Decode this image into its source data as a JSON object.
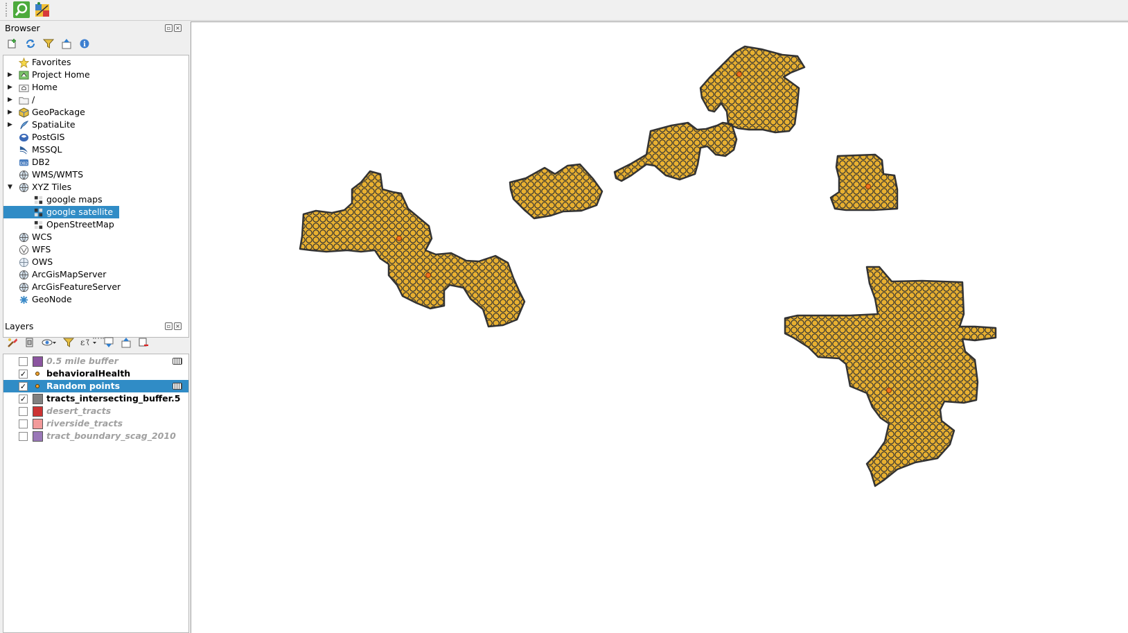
{
  "toolbar": {
    "icons": [
      "identify-icon",
      "georeference-icon"
    ]
  },
  "browser": {
    "title": "Browser",
    "tools": [
      "add-selected-icon",
      "refresh-icon",
      "filter-icon",
      "collapse-all-icon",
      "info-icon"
    ],
    "items": [
      {
        "label": "Favorites",
        "icon": "star-icon",
        "expandable": false
      },
      {
        "label": "Project Home",
        "icon": "project-home-icon",
        "expandable": true
      },
      {
        "label": "Home",
        "icon": "home-folder-icon",
        "expandable": true
      },
      {
        "label": "/",
        "icon": "folder-icon",
        "expandable": true
      },
      {
        "label": "GeoPackage",
        "icon": "geopackage-icon",
        "expandable": true
      },
      {
        "label": "SpatiaLite",
        "icon": "spatialite-icon",
        "expandable": true
      },
      {
        "label": "PostGIS",
        "icon": "postgis-icon",
        "expandable": false
      },
      {
        "label": "MSSQL",
        "icon": "mssql-icon",
        "expandable": false
      },
      {
        "label": "DB2",
        "icon": "db2-icon",
        "expandable": false
      },
      {
        "label": "WMS/WMTS",
        "icon": "globe-icon",
        "expandable": false
      },
      {
        "label": "XYZ Tiles",
        "icon": "globe-icon",
        "expandable": true,
        "expanded": true
      },
      {
        "label": "google maps",
        "icon": "tiles-icon",
        "child": true
      },
      {
        "label": "google satellite",
        "icon": "tiles-icon",
        "child": true,
        "selected": true
      },
      {
        "label": "OpenStreetMap",
        "icon": "tiles-icon",
        "child": true
      },
      {
        "label": "WCS",
        "icon": "globe-icon",
        "expandable": false
      },
      {
        "label": "WFS",
        "icon": "wfs-icon",
        "expandable": false
      },
      {
        "label": "OWS",
        "icon": "ows-icon",
        "expandable": false
      },
      {
        "label": "ArcGisMapServer",
        "icon": "globe-icon",
        "expandable": false
      },
      {
        "label": "ArcGisFeatureServer",
        "icon": "globe-icon",
        "expandable": false
      },
      {
        "label": "GeoNode",
        "icon": "geonode-icon",
        "expandable": false
      }
    ]
  },
  "layers": {
    "title": "Layers",
    "tools": [
      "style-icon",
      "add-group-icon",
      "visibility-icon",
      "filter-legend-icon",
      "expression-filter-icon",
      "expand-all-icon",
      "collapse-all-icon",
      "remove-layer-icon"
    ],
    "items": [
      {
        "name": "0.5 mile buffer",
        "checked": false,
        "symbol": "polygon",
        "color": "#8b55a0",
        "filtered": true
      },
      {
        "name": "behavioralHealth",
        "checked": true,
        "symbol": "point",
        "color": "#f0a030"
      },
      {
        "name": "Random points",
        "checked": true,
        "symbol": "point",
        "color": "#f0a030",
        "selected": true,
        "filtered": true
      },
      {
        "name": "tracts_intersecting_buffer.5",
        "checked": true,
        "symbol": "polygon",
        "color": "#808080"
      },
      {
        "name": "desert_tracts",
        "checked": false,
        "symbol": "polygon",
        "color": "#cc3333"
      },
      {
        "name": "riverside_tracts",
        "checked": false,
        "symbol": "polygon",
        "color": "#f29a9a"
      },
      {
        "name": "tract_boundary_scag_2010",
        "checked": false,
        "symbol": "polygon",
        "color": "#9a78b8"
      }
    ]
  },
  "map": {
    "fill_color": "#e8b030",
    "stroke_color": "#333333",
    "point_color": "#f07020",
    "features": [
      "cluster-west",
      "cluster-small-diamond",
      "cluster-diagonal-north",
      "cluster-east-block",
      "cluster-southeast"
    ]
  }
}
